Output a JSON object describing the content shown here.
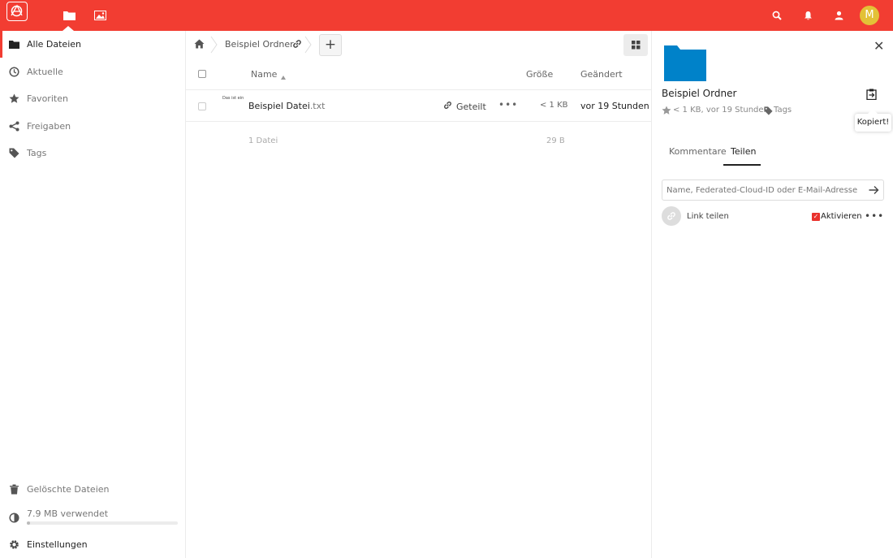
{
  "header": {
    "nav": [
      "files-icon",
      "gallery-icon"
    ],
    "right_icons": [
      "search-icon",
      "bell-icon",
      "contacts-icon"
    ],
    "avatar_letter": "M",
    "brand_color": "#f23d32"
  },
  "sidebar": {
    "items": [
      {
        "label": "Alle Dateien",
        "icon": "folder-icon"
      },
      {
        "label": "Aktuelle",
        "icon": "clock-icon"
      },
      {
        "label": "Favoriten",
        "icon": "star-icon"
      },
      {
        "label": "Freigaben",
        "icon": "share-icon"
      },
      {
        "label": "Tags",
        "icon": "tag-icon"
      }
    ],
    "deleted_label": "Gelöschte Dateien",
    "quota_label": "7.9 MB verwendet",
    "quota_fraction": 0.02,
    "settings_label": "Einstellungen"
  },
  "breadcrumb": {
    "folder": "Beispiel Ordner"
  },
  "table": {
    "headers": {
      "name": "Name",
      "size": "Größe",
      "modified": "Geändert"
    },
    "rows": [
      {
        "thumb_text": "Das ist ein",
        "name": "Beispiel Datei",
        "ext": ".txt",
        "shared_label": "Geteilt",
        "size": "< 1 KB",
        "modified": "vor 19 Stunden"
      }
    ],
    "summary": {
      "count": "1 Datei",
      "size": "29 B"
    }
  },
  "details": {
    "title": "Beispiel Ordner",
    "meta": "< 1 KB, vor 19 Stunden",
    "tags_label": "Tags",
    "tooltip": "Kopiert!",
    "tabs": [
      "Kommentare",
      "Teilen"
    ],
    "share_placeholder": "Name, Federated-Cloud-ID oder E-Mail-Adresse…",
    "link_label": "Link teilen",
    "activate_label": "Aktivieren",
    "folder_color": "#0082c9"
  }
}
